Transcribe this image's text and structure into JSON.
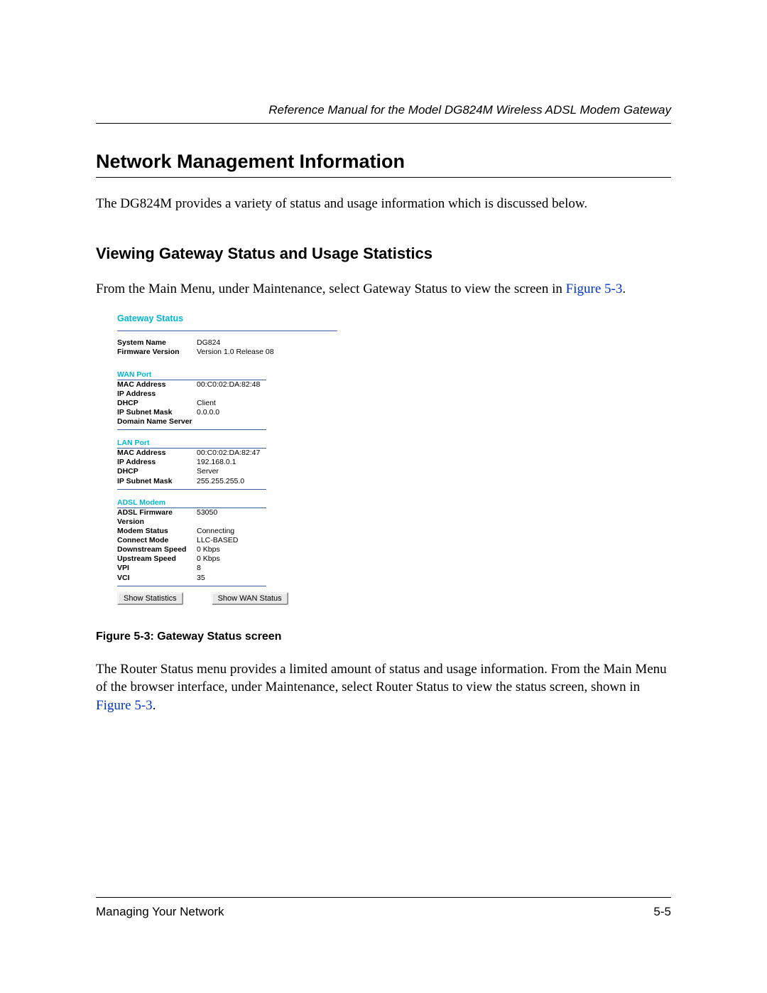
{
  "header": {
    "running": "Reference Manual for the Model DG824M Wireless ADSL Modem Gateway"
  },
  "h1": "Network Management Information",
  "p1": "The DG824M provides a variety of status and usage information which is discussed below.",
  "h2": "Viewing Gateway Status and Usage Statistics",
  "p2_a": "From the Main Menu, under Maintenance, select Gateway Status to view the screen in ",
  "p2_link": "Figure 5-3",
  "p2_b": ".",
  "figure": {
    "title": "Gateway Status",
    "system": {
      "name_label": "System Name",
      "name_value": "DG824",
      "fw_label": "Firmware Version",
      "fw_value": "Version 1.0 Release 08"
    },
    "wan": {
      "head": "WAN Port",
      "mac_label": "MAC Address",
      "mac_value": "00:C0:02:DA:82:48",
      "ip_label": "IP Address",
      "ip_value": "",
      "dhcp_label": "DHCP",
      "dhcp_value": "Client",
      "mask_label": "IP Subnet Mask",
      "mask_value": "0.0.0.0",
      "dns_label": "Domain Name Server",
      "dns_value": ""
    },
    "lan": {
      "head": "LAN Port",
      "mac_label": "MAC Address",
      "mac_value": "00:C0:02:DA:82:47",
      "ip_label": "IP Address",
      "ip_value": "192.168.0.1",
      "dhcp_label": "DHCP",
      "dhcp_value": "Server",
      "mask_label": "IP Subnet Mask",
      "mask_value": "255.255.255.0"
    },
    "adsl": {
      "head": "ADSL Modem",
      "fw_label": "ADSL Firmware Version",
      "fw_value": "53050",
      "status_label": "Modem Status",
      "status_value": "Connecting",
      "mode_label": "Connect Mode",
      "mode_value": "LLC-BASED",
      "down_label": "Downstream Speed",
      "down_value": "0 Kbps",
      "up_label": "Upstream Speed",
      "up_value": "0 Kbps",
      "vpi_label": "VPI",
      "vpi_value": "8",
      "vci_label": "VCI",
      "vci_value": "35"
    },
    "buttons": {
      "stats": "Show Statistics",
      "wan": "Show WAN Status"
    }
  },
  "fig_caption": "Figure 5-3: Gateway Status screen",
  "p3_a": "The Router Status menu provides a limited amount of status and usage information. From the Main Menu of the browser interface, under Maintenance, select Router Status to view the status screen, shown in ",
  "p3_link": "Figure 5-3",
  "p3_b": ".",
  "footer": {
    "left": "Managing Your Network",
    "right": "5-5"
  }
}
